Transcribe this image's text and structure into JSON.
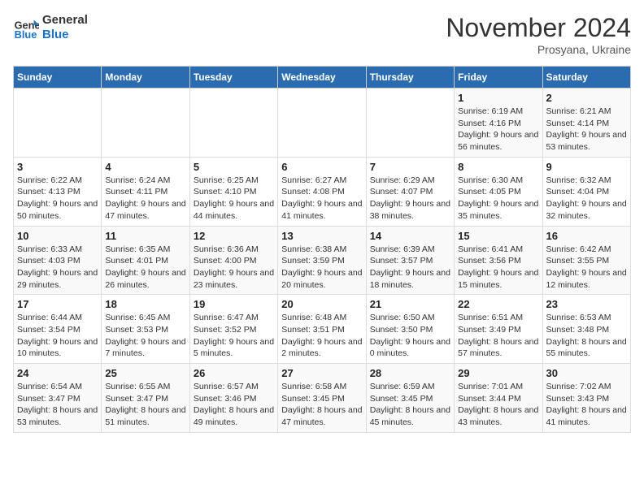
{
  "logo": {
    "line1": "General",
    "line2": "Blue"
  },
  "title": "November 2024",
  "subtitle": "Prosyana, Ukraine",
  "days_of_week": [
    "Sunday",
    "Monday",
    "Tuesday",
    "Wednesday",
    "Thursday",
    "Friday",
    "Saturday"
  ],
  "weeks": [
    [
      {
        "num": "",
        "info": ""
      },
      {
        "num": "",
        "info": ""
      },
      {
        "num": "",
        "info": ""
      },
      {
        "num": "",
        "info": ""
      },
      {
        "num": "",
        "info": ""
      },
      {
        "num": "1",
        "info": "Sunrise: 6:19 AM\nSunset: 4:16 PM\nDaylight: 9 hours and 56 minutes."
      },
      {
        "num": "2",
        "info": "Sunrise: 6:21 AM\nSunset: 4:14 PM\nDaylight: 9 hours and 53 minutes."
      }
    ],
    [
      {
        "num": "3",
        "info": "Sunrise: 6:22 AM\nSunset: 4:13 PM\nDaylight: 9 hours and 50 minutes."
      },
      {
        "num": "4",
        "info": "Sunrise: 6:24 AM\nSunset: 4:11 PM\nDaylight: 9 hours and 47 minutes."
      },
      {
        "num": "5",
        "info": "Sunrise: 6:25 AM\nSunset: 4:10 PM\nDaylight: 9 hours and 44 minutes."
      },
      {
        "num": "6",
        "info": "Sunrise: 6:27 AM\nSunset: 4:08 PM\nDaylight: 9 hours and 41 minutes."
      },
      {
        "num": "7",
        "info": "Sunrise: 6:29 AM\nSunset: 4:07 PM\nDaylight: 9 hours and 38 minutes."
      },
      {
        "num": "8",
        "info": "Sunrise: 6:30 AM\nSunset: 4:05 PM\nDaylight: 9 hours and 35 minutes."
      },
      {
        "num": "9",
        "info": "Sunrise: 6:32 AM\nSunset: 4:04 PM\nDaylight: 9 hours and 32 minutes."
      }
    ],
    [
      {
        "num": "10",
        "info": "Sunrise: 6:33 AM\nSunset: 4:03 PM\nDaylight: 9 hours and 29 minutes."
      },
      {
        "num": "11",
        "info": "Sunrise: 6:35 AM\nSunset: 4:01 PM\nDaylight: 9 hours and 26 minutes."
      },
      {
        "num": "12",
        "info": "Sunrise: 6:36 AM\nSunset: 4:00 PM\nDaylight: 9 hours and 23 minutes."
      },
      {
        "num": "13",
        "info": "Sunrise: 6:38 AM\nSunset: 3:59 PM\nDaylight: 9 hours and 20 minutes."
      },
      {
        "num": "14",
        "info": "Sunrise: 6:39 AM\nSunset: 3:57 PM\nDaylight: 9 hours and 18 minutes."
      },
      {
        "num": "15",
        "info": "Sunrise: 6:41 AM\nSunset: 3:56 PM\nDaylight: 9 hours and 15 minutes."
      },
      {
        "num": "16",
        "info": "Sunrise: 6:42 AM\nSunset: 3:55 PM\nDaylight: 9 hours and 12 minutes."
      }
    ],
    [
      {
        "num": "17",
        "info": "Sunrise: 6:44 AM\nSunset: 3:54 PM\nDaylight: 9 hours and 10 minutes."
      },
      {
        "num": "18",
        "info": "Sunrise: 6:45 AM\nSunset: 3:53 PM\nDaylight: 9 hours and 7 minutes."
      },
      {
        "num": "19",
        "info": "Sunrise: 6:47 AM\nSunset: 3:52 PM\nDaylight: 9 hours and 5 minutes."
      },
      {
        "num": "20",
        "info": "Sunrise: 6:48 AM\nSunset: 3:51 PM\nDaylight: 9 hours and 2 minutes."
      },
      {
        "num": "21",
        "info": "Sunrise: 6:50 AM\nSunset: 3:50 PM\nDaylight: 9 hours and 0 minutes."
      },
      {
        "num": "22",
        "info": "Sunrise: 6:51 AM\nSunset: 3:49 PM\nDaylight: 8 hours and 57 minutes."
      },
      {
        "num": "23",
        "info": "Sunrise: 6:53 AM\nSunset: 3:48 PM\nDaylight: 8 hours and 55 minutes."
      }
    ],
    [
      {
        "num": "24",
        "info": "Sunrise: 6:54 AM\nSunset: 3:47 PM\nDaylight: 8 hours and 53 minutes."
      },
      {
        "num": "25",
        "info": "Sunrise: 6:55 AM\nSunset: 3:47 PM\nDaylight: 8 hours and 51 minutes."
      },
      {
        "num": "26",
        "info": "Sunrise: 6:57 AM\nSunset: 3:46 PM\nDaylight: 8 hours and 49 minutes."
      },
      {
        "num": "27",
        "info": "Sunrise: 6:58 AM\nSunset: 3:45 PM\nDaylight: 8 hours and 47 minutes."
      },
      {
        "num": "28",
        "info": "Sunrise: 6:59 AM\nSunset: 3:45 PM\nDaylight: 8 hours and 45 minutes."
      },
      {
        "num": "29",
        "info": "Sunrise: 7:01 AM\nSunset: 3:44 PM\nDaylight: 8 hours and 43 minutes."
      },
      {
        "num": "30",
        "info": "Sunrise: 7:02 AM\nSunset: 3:43 PM\nDaylight: 8 hours and 41 minutes."
      }
    ]
  ]
}
